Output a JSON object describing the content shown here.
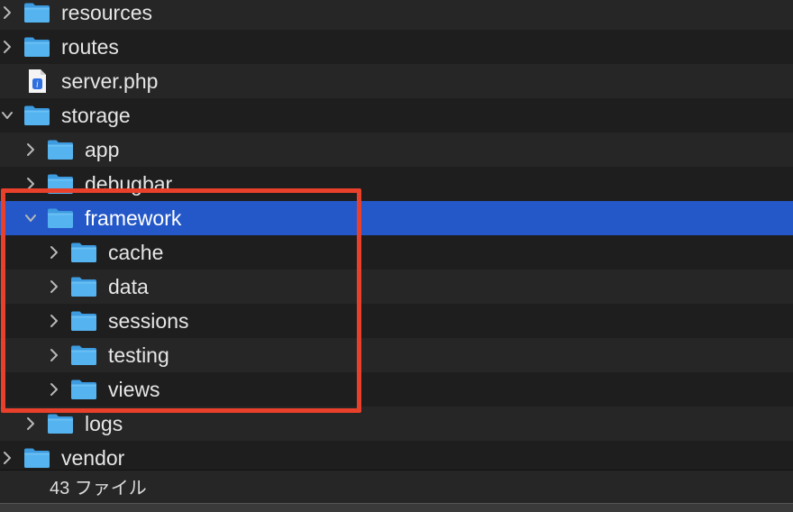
{
  "window": {
    "section": "file-tree"
  },
  "colors": {
    "selection": "#2458c8",
    "highlight_box": "#e8402a",
    "folder_fill": "#55b4f0",
    "folder_tab": "#3d9be0",
    "text": "#e6e6e6"
  },
  "tree": [
    {
      "label": "resources",
      "kind": "folder",
      "expanded": false,
      "depth": 0
    },
    {
      "label": "routes",
      "kind": "folder",
      "expanded": false,
      "depth": 0
    },
    {
      "label": "server.php",
      "kind": "php-file",
      "expanded": null,
      "depth": 0
    },
    {
      "label": "storage",
      "kind": "folder",
      "expanded": true,
      "depth": 0
    },
    {
      "label": "app",
      "kind": "folder",
      "expanded": false,
      "depth": 1
    },
    {
      "label": "debugbar",
      "kind": "folder",
      "expanded": false,
      "depth": 1
    },
    {
      "label": "framework",
      "kind": "folder",
      "expanded": true,
      "depth": 1,
      "selected": true
    },
    {
      "label": "cache",
      "kind": "folder",
      "expanded": false,
      "depth": 2
    },
    {
      "label": "data",
      "kind": "folder",
      "expanded": false,
      "depth": 2
    },
    {
      "label": "sessions",
      "kind": "folder",
      "expanded": false,
      "depth": 2
    },
    {
      "label": "testing",
      "kind": "folder",
      "expanded": false,
      "depth": 2
    },
    {
      "label": "views",
      "kind": "folder",
      "expanded": false,
      "depth": 2
    },
    {
      "label": "logs",
      "kind": "folder",
      "expanded": false,
      "depth": 1
    },
    {
      "label": "vendor",
      "kind": "folder",
      "expanded": false,
      "depth": 0
    }
  ],
  "status_bar": {
    "file_count": "43 ファイル"
  }
}
